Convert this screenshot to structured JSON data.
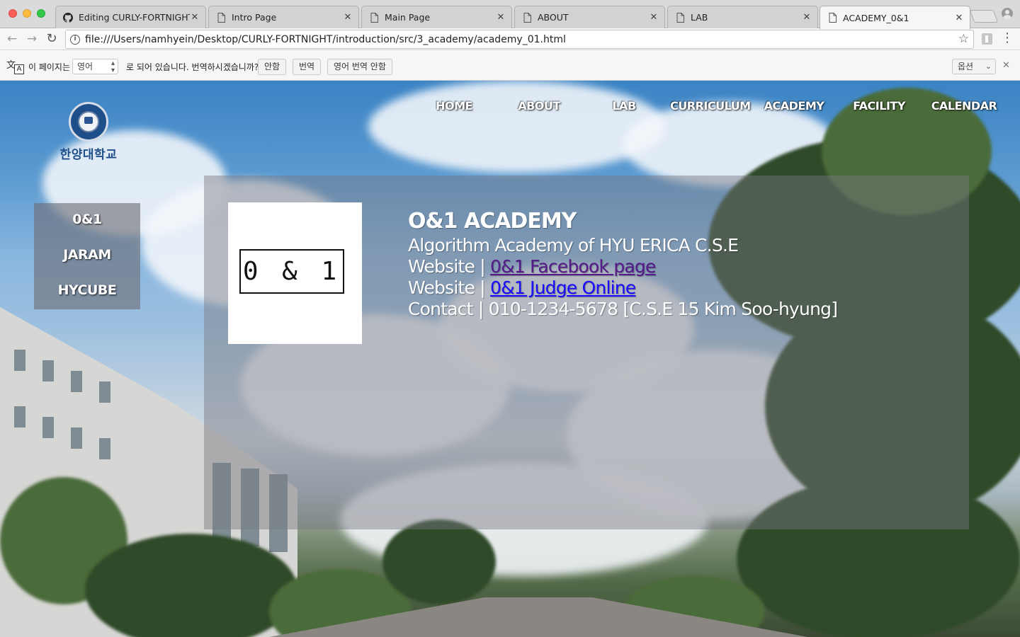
{
  "browser": {
    "tabs": [
      {
        "title": "Editing CURLY-FORTNIGHT/",
        "icon": "github-icon",
        "active": false
      },
      {
        "title": "Intro Page",
        "icon": "page-icon",
        "active": false
      },
      {
        "title": "Main Page",
        "icon": "page-icon",
        "active": false
      },
      {
        "title": "ABOUT",
        "icon": "page-icon",
        "active": false
      },
      {
        "title": "LAB",
        "icon": "page-icon",
        "active": false
      },
      {
        "title": "ACADEMY_0&1",
        "icon": "page-icon",
        "active": true
      }
    ],
    "url": "file:///Users/namhyein/Desktop/CURLY-FORTNIGHT/introduction/src/3_academy/academy_01.html",
    "translate_bar": {
      "prefix": "이 페이지는",
      "language": "영어",
      "middle": "로 되어 있습니다. 번역하시겠습니까?",
      "no_button": "안함",
      "translate_button": "번역",
      "never_button": "영어 번역 안함",
      "options": "옵션"
    }
  },
  "site": {
    "logo_text": "한양대학교",
    "nav": [
      "HOME",
      "ABOUT",
      "LAB",
      "CURRICULUM",
      "ACADEMY",
      "FACILITY",
      "CALENDAR"
    ],
    "side_menu": [
      "0&1",
      "JARAM",
      "HYCUBE"
    ],
    "academy": {
      "logo_text": "0 & 1",
      "title": "O&1 ACADEMY",
      "subtitle": "Algorithm Academy of HYU ERICA C.S.E",
      "website_label": "Website |",
      "facebook_link": "0&1 Facebook page",
      "judge_link": "0&1 Judge Online",
      "contact_label": "Contact |",
      "contact_value": "010-1234-5678 [C.S.E 15 Kim Soo-hyung]"
    }
  },
  "colors": {
    "visited_link": "#551a8b",
    "link": "#1a0dff",
    "seal_blue": "#1f4f8a"
  }
}
